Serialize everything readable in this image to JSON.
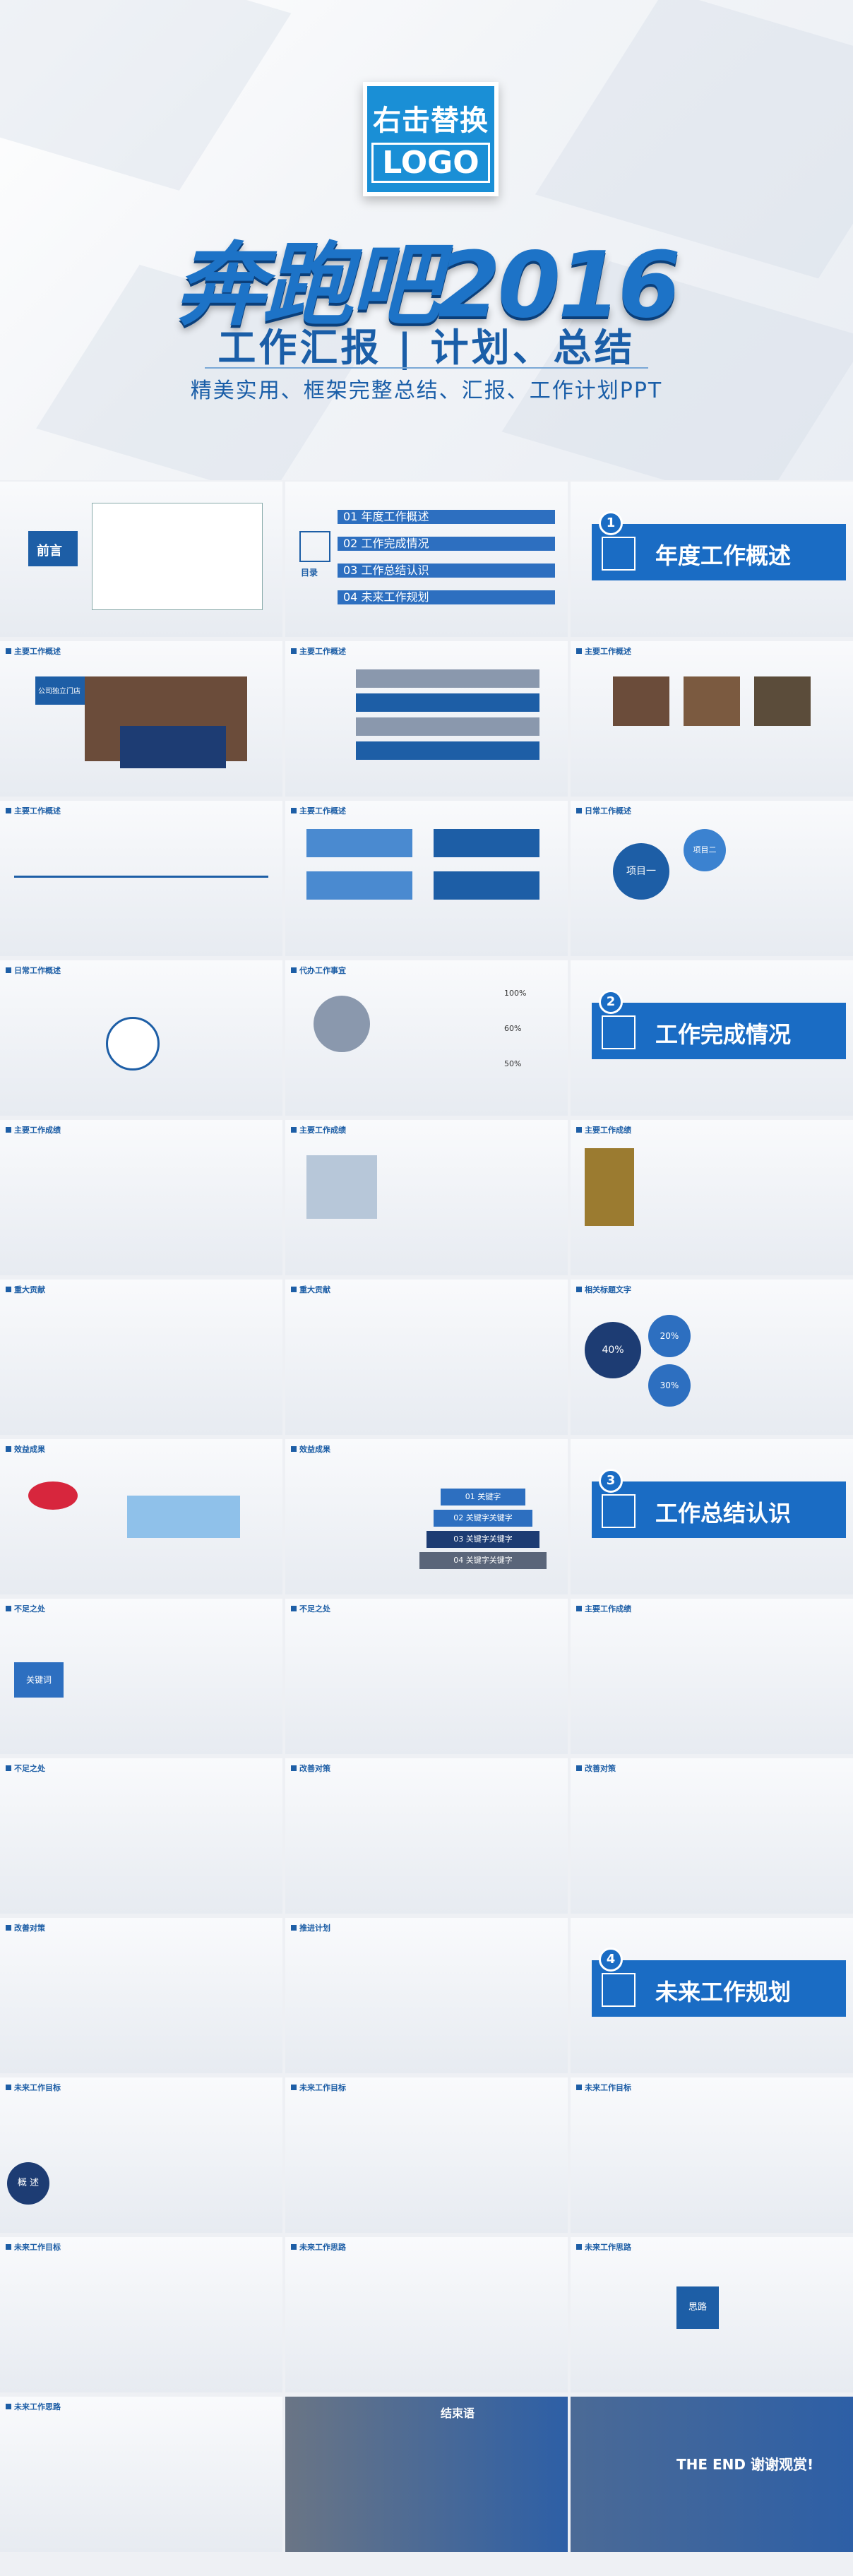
{
  "hero": {
    "logo_line1": "右击替换",
    "logo_line2": "LOGO",
    "title": "奔跑吧2016",
    "subtitle": "工作汇报 | 计划、总结",
    "description": "精美实用、框架完整总结、汇报、工作计划PPT"
  },
  "slides": {
    "preface_label": "前言",
    "toc_label": "目录",
    "toc_items": [
      {
        "num": "01",
        "label": "年度工作概述"
      },
      {
        "num": "02",
        "label": "工作完成情况"
      },
      {
        "num": "03",
        "label": "工作总结认识"
      },
      {
        "num": "04",
        "label": "未来工作规划"
      }
    ],
    "sections": [
      {
        "num": "1",
        "label": "年度工作概述"
      },
      {
        "num": "2",
        "label": "工作完成情况"
      },
      {
        "num": "3",
        "label": "工作总结认识"
      },
      {
        "num": "4",
        "label": "未来工作规划"
      }
    ],
    "tags": {
      "main_overview": "主要工作概述",
      "daily": "日常工作概述",
      "agency": "代办工作事宜",
      "results": "主要工作成绩",
      "contribution": "重大贡献",
      "related": "相关标题文字",
      "effect": "效益成果",
      "shortcoming": "不足之处",
      "improve": "改善对策",
      "plan": "推进计划",
      "future_goal": "未来工作目标",
      "future_idea": "未来工作思路"
    },
    "company_name": "公司独立门店",
    "project_one": "项目一",
    "project_two": "项目二",
    "percent_100": "100%",
    "percent_60": "60%",
    "percent_50": "50%",
    "stat_40": "40%",
    "stat_20": "20%",
    "stat_30": "30%",
    "key_rows": [
      "01 关键字",
      "02 关键字关键字",
      "03 关键字关键字",
      "04 关键字关键字"
    ],
    "key_person": "关键词",
    "concept": "概 述",
    "ending_title": "结束语",
    "ending_thanks": "THE END 谢谢观赏!",
    "overview_word": "思路"
  }
}
